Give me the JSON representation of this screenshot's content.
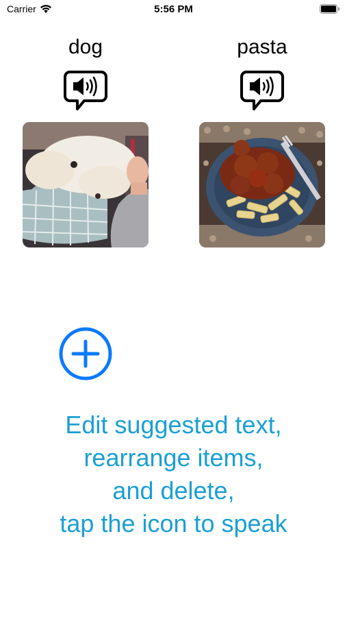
{
  "status_bar": {
    "carrier": "Carrier",
    "time": "5:56 PM",
    "icons": [
      "wifi-icon",
      "battery-icon"
    ]
  },
  "cards": [
    {
      "label": "dog",
      "speak_icon": "speaker-bubble-icon",
      "image": "dog-photo"
    },
    {
      "label": "pasta",
      "speak_icon": "speaker-bubble-icon",
      "image": "pasta-photo"
    }
  ],
  "add_button": {
    "icon": "plus-circle-icon",
    "color": "#0a7aff"
  },
  "instructions": {
    "line1": "Edit suggested text,",
    "line2": "rearrange items,",
    "line3": "and delete,",
    "line4": "tap the icon to speak",
    "color": "#1a9fd4"
  }
}
